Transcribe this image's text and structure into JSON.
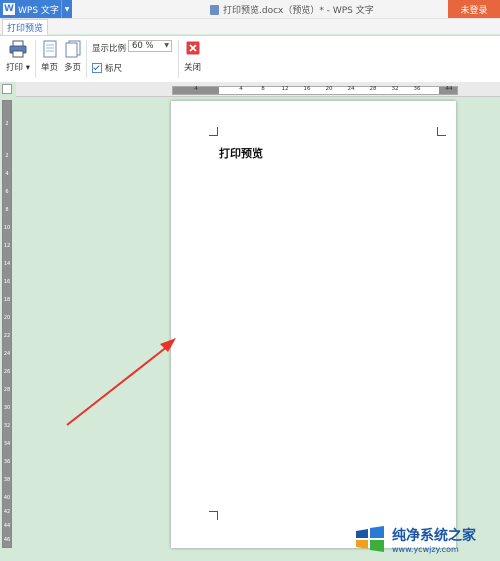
{
  "titlebar": {
    "app_name": "WPS 文字",
    "app_logo": "W",
    "doc_title": "打印预览.docx（预览）* - WPS 文字",
    "login_label": "未登录"
  },
  "tabs": [
    {
      "label": "打印预览"
    }
  ],
  "ribbon": {
    "print_label": "打印",
    "single_page_label": "单页",
    "multi_page_label": "多页",
    "zoom_label": "显示比例",
    "zoom_value": "60 %",
    "ruler_label": "标尺",
    "ruler_checked": true,
    "close_label": "关闭"
  },
  "h_ruler_ticks": [
    "4",
    "4",
    "8",
    "12",
    "16",
    "20",
    "24",
    "28",
    "32",
    "36",
    "44"
  ],
  "v_ruler_ticks": [
    "2",
    "2",
    "4",
    "6",
    "8",
    "10",
    "12",
    "14",
    "16",
    "18",
    "20",
    "22",
    "24",
    "26",
    "28",
    "30",
    "32",
    "34",
    "36",
    "38",
    "40",
    "42",
    "44",
    "46"
  ],
  "page": {
    "heading": "打印预览"
  },
  "watermark": {
    "main": "纯净系统之家",
    "url": "www.ycwjzy.com"
  },
  "colors": {
    "app_blue": "#3d7fd6",
    "login_orange": "#e8663d",
    "workspace_green": "#d4e9d8",
    "arrow_red": "#e8312a",
    "close_red": "#e04040"
  }
}
